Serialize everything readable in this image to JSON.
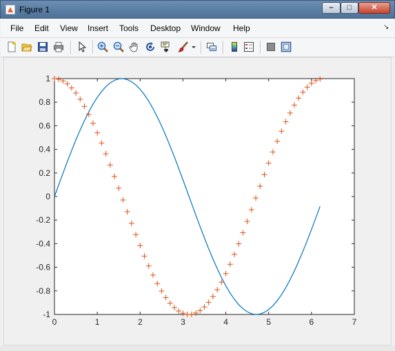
{
  "window": {
    "title": "Figure 1",
    "buttons": {
      "minimize": "–",
      "maximize": "□",
      "close": "✕"
    }
  },
  "menu": [
    "File",
    "Edit",
    "View",
    "Insert",
    "Tools",
    "Desktop",
    "Window",
    "Help"
  ],
  "menu_dock_arrow": "↘",
  "toolbar": {
    "icons": [
      "new-figure-icon",
      "open-file-icon",
      "save-icon",
      "print-icon",
      "edit-plot-arrow-icon",
      "zoom-in-icon",
      "zoom-out-icon",
      "pan-hand-icon",
      "rotate-3d-icon",
      "data-cursor-icon",
      "brush-icon",
      "brush-dropdown-icon",
      "link-plot-icon",
      "insert-colorbar-icon",
      "insert-legend-icon",
      "hide-plot-tools-icon",
      "show-plot-tools-icon"
    ]
  },
  "colors": {
    "sine": "#0072bd",
    "cosine_markers": "#d95319",
    "axes_bg": "#ffffff",
    "figure_bg": "#f0f0f0"
  },
  "chart_data": {
    "type": "line",
    "title": "",
    "xlabel": "",
    "ylabel": "",
    "xlim": [
      0,
      7
    ],
    "ylim": [
      -1,
      1
    ],
    "xticks": [
      "0",
      "1",
      "2",
      "3",
      "4",
      "5",
      "6",
      "7"
    ],
    "yticks": [
      "-1",
      "-0.8",
      "-0.6",
      "-0.4",
      "-0.2",
      "0",
      "0.2",
      "0.4",
      "0.6",
      "0.8",
      "1"
    ],
    "grid": false,
    "series": [
      {
        "function": "sin(x)",
        "style": "solid line",
        "x_start": 0,
        "x_end": 6.2,
        "x_step": 0.1
      },
      {
        "function": "cos(x)",
        "style": "+ markers",
        "x_start": 0,
        "x_end": 6.2,
        "x_step": 0.1
      }
    ]
  }
}
